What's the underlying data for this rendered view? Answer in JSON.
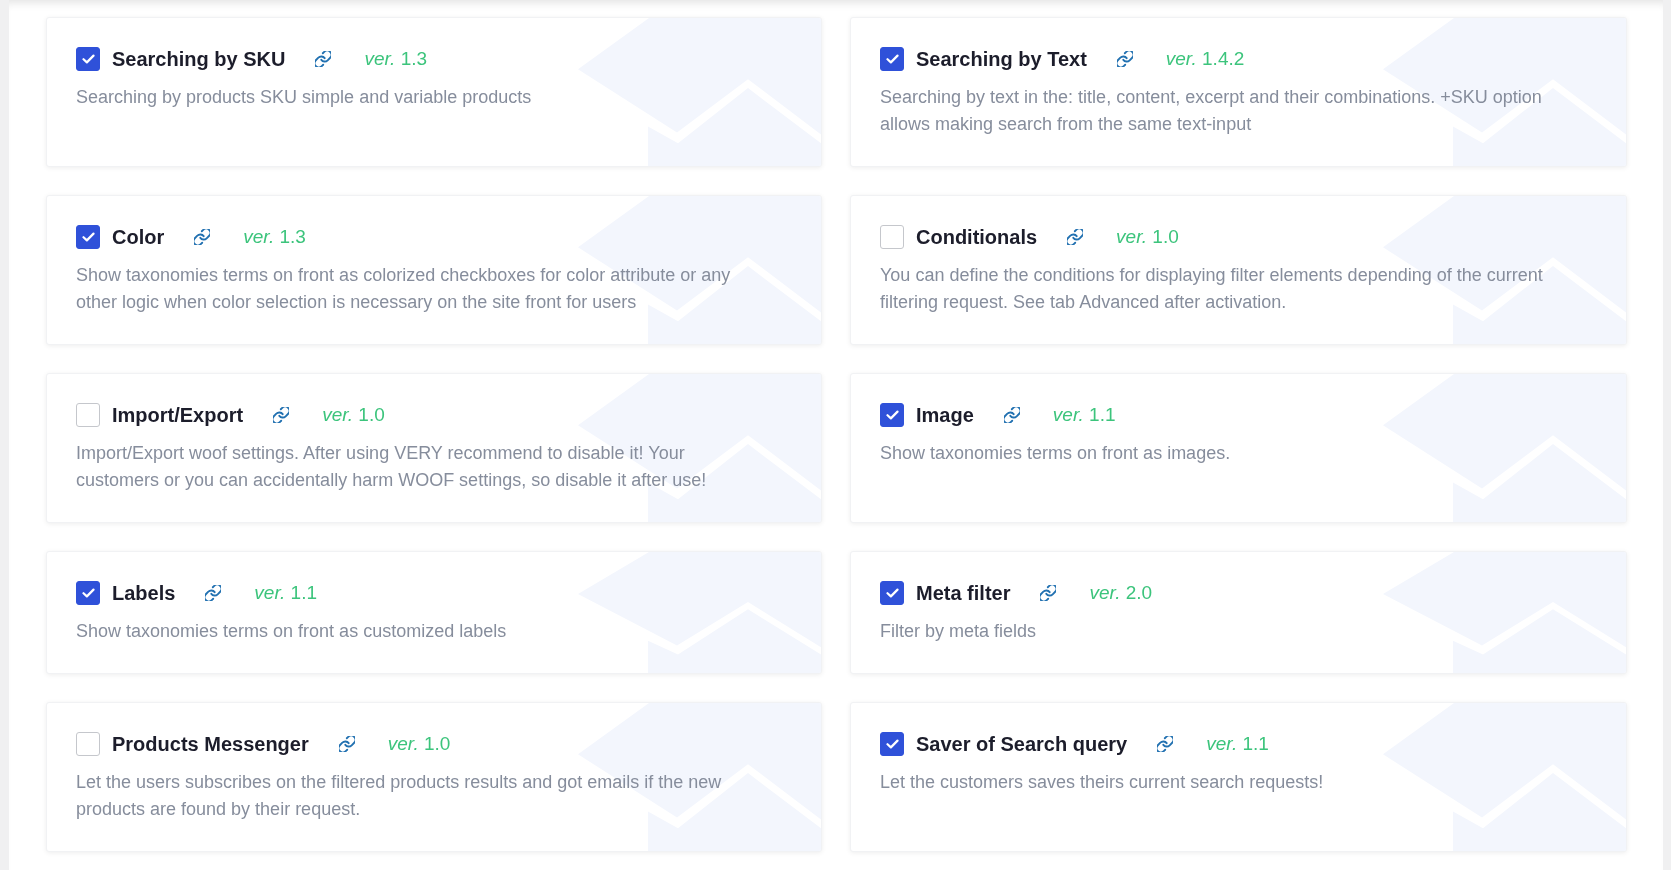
{
  "extensions": [
    {
      "title": "Searching by SKU",
      "checked": true,
      "version": "*ver.* 1.3",
      "description": "Searching by products SKU simple and variable products"
    },
    {
      "title": "Searching by Text",
      "checked": true,
      "version": "*ver.* 1.4.2",
      "description": "Searching by text in the: title, content, excerpt and their combinations. +SKU option allows making search from the same text-input"
    },
    {
      "title": "Color",
      "checked": true,
      "version": "*ver.* 1.3",
      "description": "Show taxonomies terms on front as colorized checkboxes for color attribute or any other logic when color selection is necessary on the site front for users"
    },
    {
      "title": "Conditionals",
      "checked": false,
      "version": "*ver.* 1.0",
      "description": "You can define the conditions for displaying filter elements depending of the current filtering request. See tab Advanced after activation."
    },
    {
      "title": "Import/Export",
      "checked": false,
      "version": "*ver.* 1.0",
      "description": "Import/Export woof settings. After using VERY recommend to disable it! Your customers or you can accidentally harm WOOF settings, so disable it after use!"
    },
    {
      "title": "Image",
      "checked": true,
      "version": "*ver.* 1.1",
      "description": "Show taxonomies terms on front as images."
    },
    {
      "title": "Labels",
      "checked": true,
      "version": "*ver.* 1.1",
      "description": "Show taxonomies terms on front as customized labels"
    },
    {
      "title": "Meta filter",
      "checked": true,
      "version": "*ver.* 2.0",
      "description": "Filter by meta fields"
    },
    {
      "title": "Products Messenger",
      "checked": false,
      "version": "*ver.* 1.0",
      "description": "Let the users subscribes on the filtered products results and got emails if the new products are found by their request."
    },
    {
      "title": "Saver of Search query",
      "checked": true,
      "version": "*ver.* 1.1",
      "description": "Let the customers saves theirs current search requests!"
    }
  ]
}
